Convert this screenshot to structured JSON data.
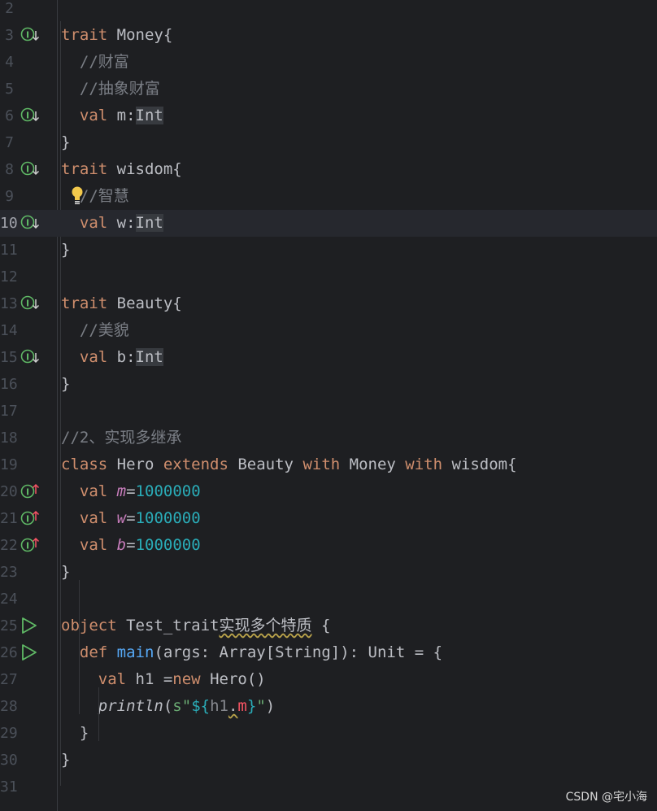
{
  "lines": [
    {
      "no": "2"
    },
    {
      "no": "3",
      "icon": "implemented-down",
      "parts": [
        [
          "kw",
          "trait"
        ],
        [
          "t",
          " Money{"
        ]
      ]
    },
    {
      "no": "4",
      "parts": [
        [
          "t",
          "  "
        ],
        [
          "cmt",
          "//财富"
        ]
      ]
    },
    {
      "no": "5",
      "parts": [
        [
          "t",
          "  "
        ],
        [
          "cmt",
          "//抽象财富"
        ]
      ]
    },
    {
      "no": "6",
      "icon": "implemented-down",
      "parts": [
        [
          "t",
          "  "
        ],
        [
          "kw",
          "val"
        ],
        [
          "t",
          " m:"
        ],
        [
          "hl-type",
          "Int"
        ]
      ]
    },
    {
      "no": "7",
      "parts": [
        [
          "t",
          "}"
        ]
      ]
    },
    {
      "no": "8",
      "icon": "implemented-down",
      "parts": [
        [
          "kw",
          "trait"
        ],
        [
          "t",
          " wisdom{"
        ]
      ]
    },
    {
      "no": "9",
      "bulb": true,
      "parts": [
        [
          "t",
          "  "
        ],
        [
          "cmt",
          "//智慧"
        ]
      ]
    },
    {
      "no": "10",
      "icon": "implemented-down",
      "current": true,
      "parts": [
        [
          "t",
          "  "
        ],
        [
          "kw",
          "val"
        ],
        [
          "t",
          " w:"
        ],
        [
          "hl-type",
          "Int"
        ]
      ]
    },
    {
      "no": "11",
      "parts": [
        [
          "t",
          "}"
        ]
      ]
    },
    {
      "no": "12"
    },
    {
      "no": "13",
      "icon": "implemented-down",
      "parts": [
        [
          "kw",
          "trait"
        ],
        [
          "t",
          " Beauty{"
        ]
      ]
    },
    {
      "no": "14",
      "parts": [
        [
          "t",
          "  "
        ],
        [
          "cmt",
          "//美貌"
        ]
      ]
    },
    {
      "no": "15",
      "icon": "implemented-down",
      "parts": [
        [
          "t",
          "  "
        ],
        [
          "kw",
          "val"
        ],
        [
          "t",
          " b:"
        ],
        [
          "hl-type",
          "Int"
        ]
      ]
    },
    {
      "no": "16",
      "parts": [
        [
          "t",
          "}"
        ]
      ]
    },
    {
      "no": "17"
    },
    {
      "no": "18",
      "parts": [
        [
          "cmt",
          "//2、实现多继承"
        ]
      ]
    },
    {
      "no": "19",
      "parts": [
        [
          "kw",
          "class"
        ],
        [
          "t",
          " Hero "
        ],
        [
          "kw",
          "extends"
        ],
        [
          "t",
          " Beauty "
        ],
        [
          "kw",
          "with"
        ],
        [
          "t",
          " Money "
        ],
        [
          "kw",
          "with"
        ],
        [
          "t",
          " wisdom{"
        ]
      ]
    },
    {
      "no": "20",
      "icon": "implements-up",
      "parts": [
        [
          "t",
          "  "
        ],
        [
          "kw",
          "val"
        ],
        [
          "t",
          " "
        ],
        [
          "italic-field",
          "m"
        ],
        [
          "t",
          "="
        ],
        [
          "num",
          "1000000"
        ]
      ]
    },
    {
      "no": "21",
      "icon": "implements-up",
      "parts": [
        [
          "t",
          "  "
        ],
        [
          "kw",
          "val"
        ],
        [
          "t",
          " "
        ],
        [
          "italic-field",
          "w"
        ],
        [
          "t",
          "="
        ],
        [
          "num",
          "1000000"
        ]
      ]
    },
    {
      "no": "22",
      "icon": "implements-up",
      "parts": [
        [
          "t",
          "  "
        ],
        [
          "kw",
          "val"
        ],
        [
          "t",
          " "
        ],
        [
          "italic-field",
          "b"
        ],
        [
          "t",
          "="
        ],
        [
          "num",
          "1000000"
        ]
      ]
    },
    {
      "no": "23",
      "parts": [
        [
          "t",
          "}"
        ]
      ]
    },
    {
      "no": "24"
    },
    {
      "no": "25",
      "icon": "run",
      "parts": [
        [
          "kw",
          "object"
        ],
        [
          "t",
          " Test_trait"
        ],
        [
          "squiggle-y",
          "实现多个特质"
        ],
        [
          "t",
          " {"
        ]
      ]
    },
    {
      "no": "26",
      "icon": "run",
      "parts": [
        [
          "t",
          "  "
        ],
        [
          "kw",
          "def"
        ],
        [
          "t",
          " "
        ],
        [
          "fn",
          "main"
        ],
        [
          "t",
          "(args: Array[String]): Unit = {"
        ]
      ]
    },
    {
      "no": "27",
      "parts": [
        [
          "t",
          "    "
        ],
        [
          "kw",
          "val"
        ],
        [
          "t",
          " h1 ="
        ],
        [
          "kw",
          "new"
        ],
        [
          "t",
          " Hero()"
        ]
      ]
    },
    {
      "no": "28",
      "parts": [
        [
          "t",
          "    "
        ],
        [
          "italic-fn",
          "println"
        ],
        [
          "t",
          "("
        ],
        [
          "str",
          "s\""
        ],
        [
          "tmpl",
          "${"
        ],
        [
          "dim",
          "h1"
        ],
        [
          "squiggle-y",
          ".",
          ""
        ],
        [
          "red",
          "m"
        ],
        [
          "tmpl",
          "}"
        ],
        [
          "str",
          "\""
        ],
        [
          "t",
          ")"
        ]
      ]
    },
    {
      "no": "29",
      "parts": [
        [
          "t",
          "  }"
        ]
      ]
    },
    {
      "no": "30",
      "parts": [
        [
          "t",
          "}"
        ]
      ]
    },
    {
      "no": "31"
    }
  ],
  "watermark": "CSDN @宅小海",
  "colors": {
    "keyword": "#cf8e6d",
    "number": "#2aacb8",
    "comment": "#7a7e85",
    "function": "#56a8f5",
    "field": "#c77dbb"
  }
}
